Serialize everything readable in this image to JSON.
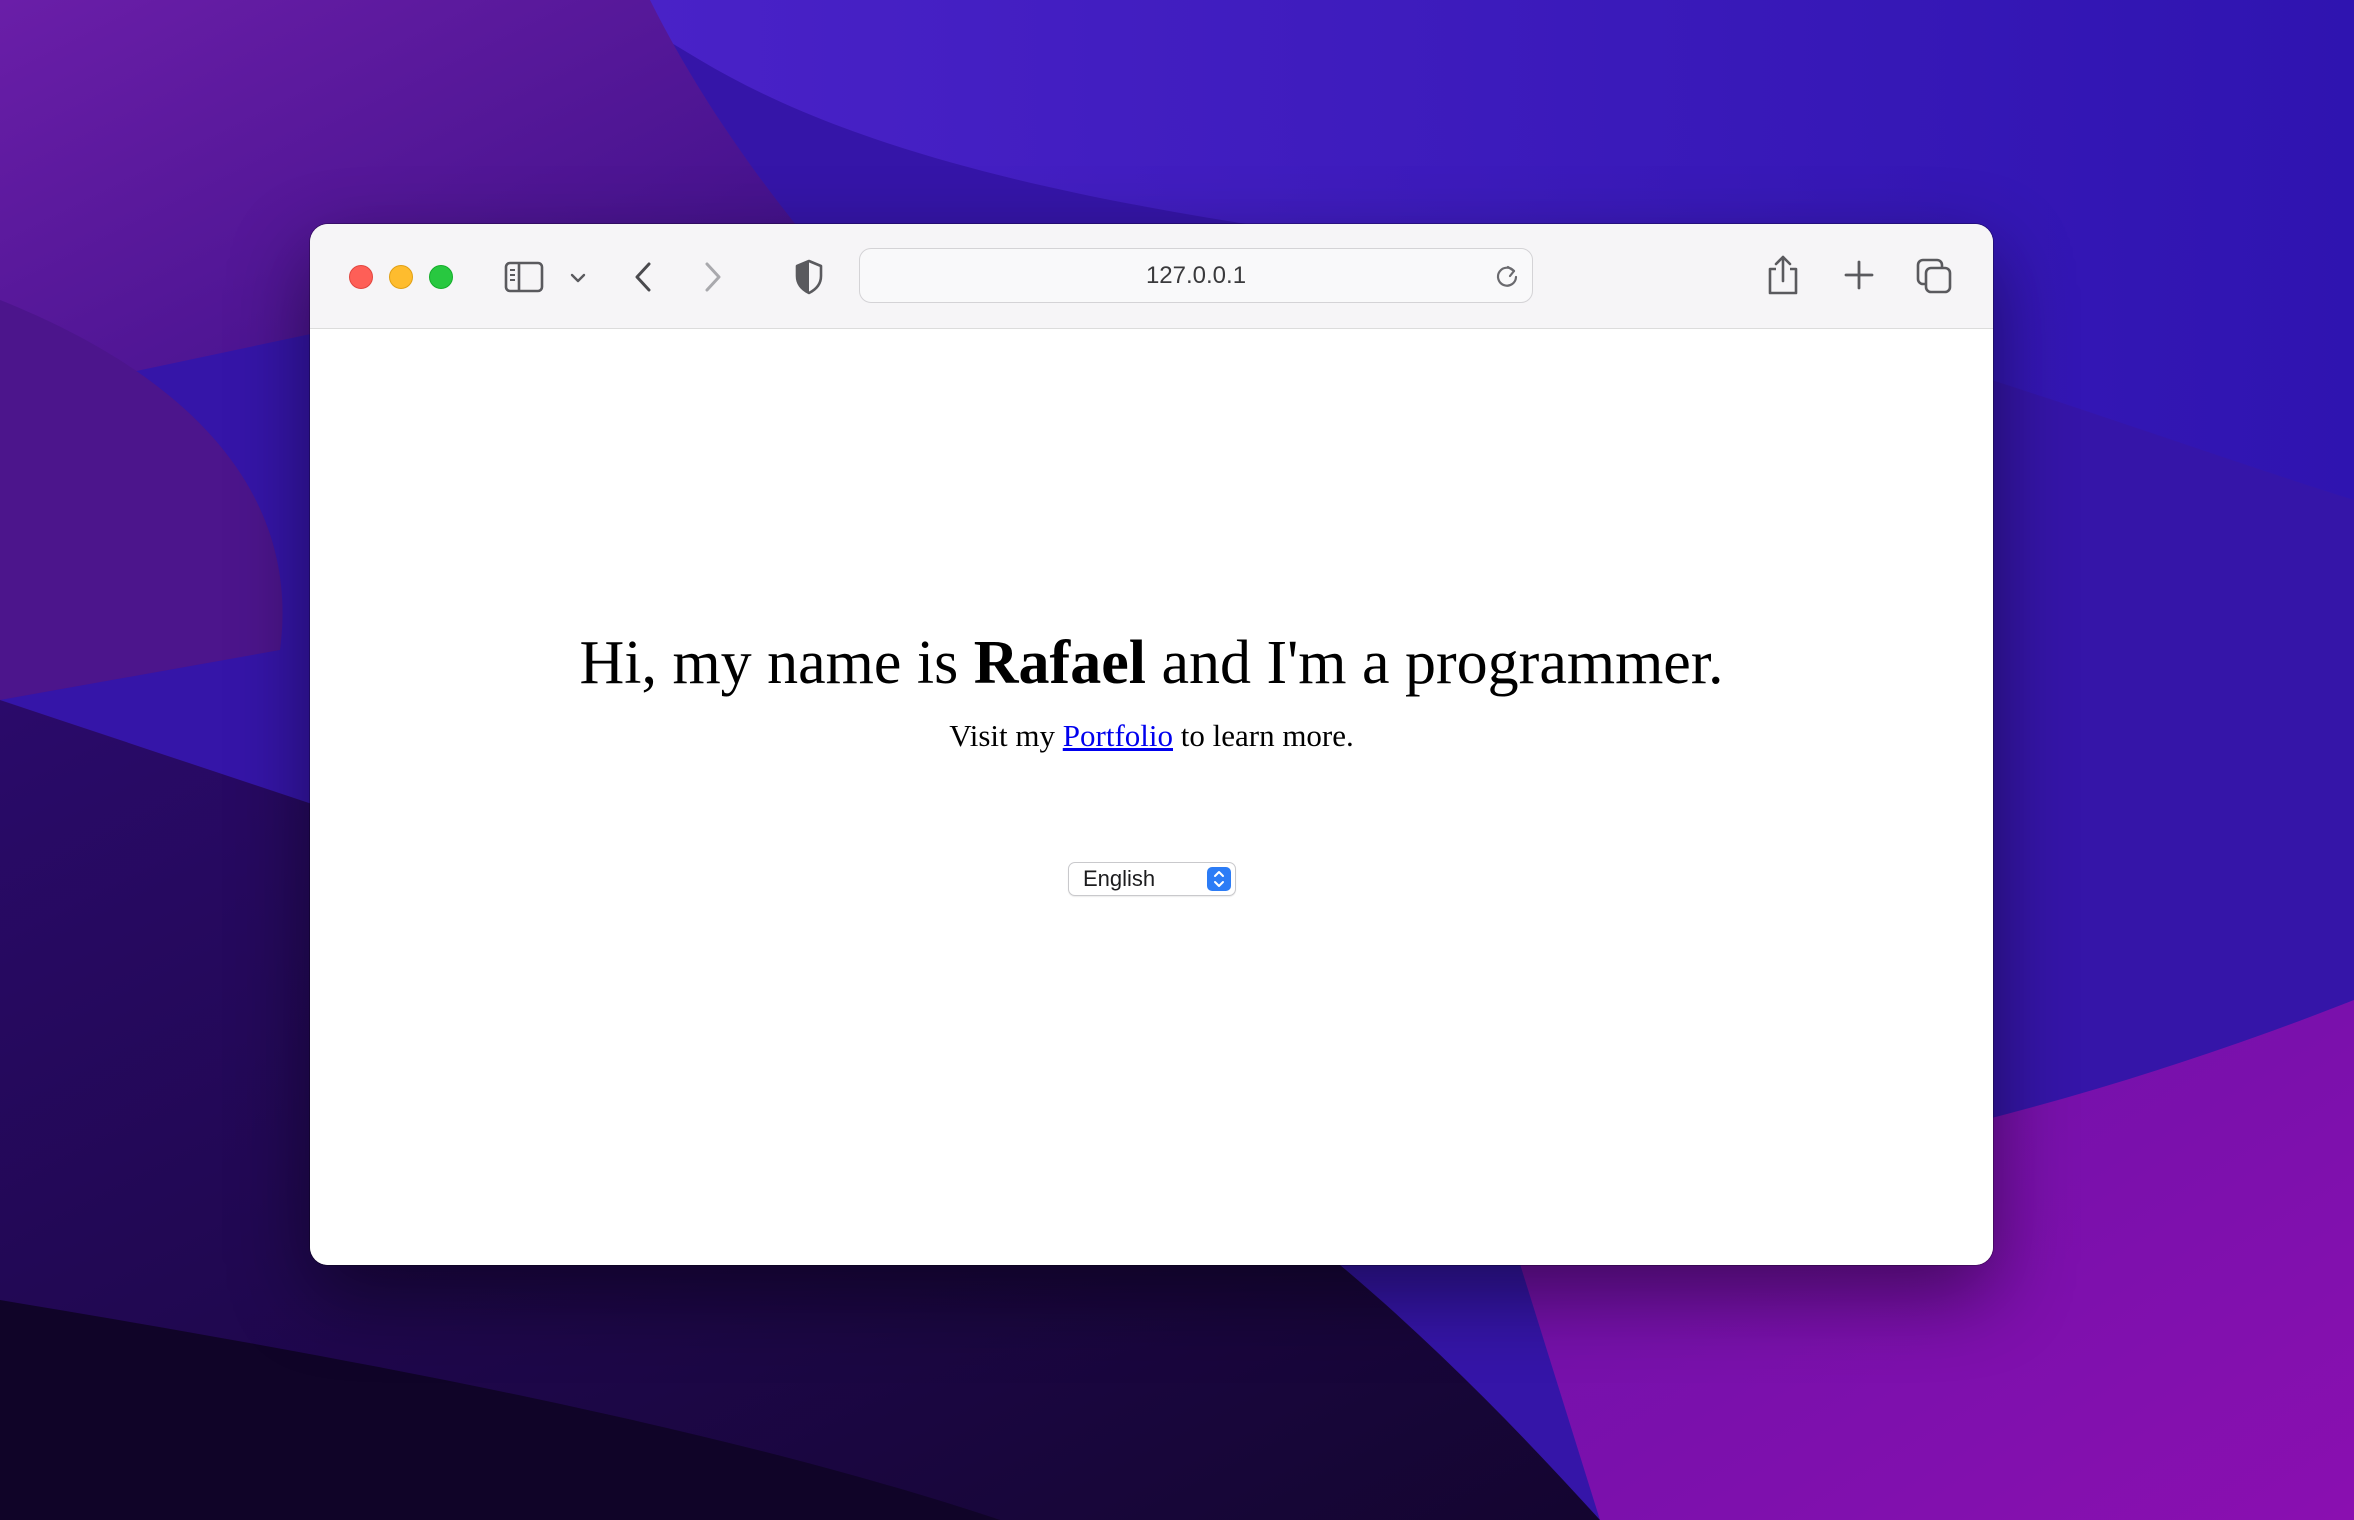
{
  "browser": {
    "address": "127.0.0.1",
    "icons": {
      "sidebar": "sidebar-icon",
      "sidebar_menu": "chevron-down-icon",
      "back": "chevron-left-icon",
      "forward": "chevron-right-icon",
      "privacy": "shield-icon",
      "reload": "reload-icon",
      "share": "share-icon",
      "new_tab": "plus-icon",
      "tab_overview": "tabs-icon"
    },
    "colors": {
      "close": "#fe5f57",
      "minimize": "#febc2e",
      "zoom": "#28c840"
    }
  },
  "page": {
    "headline_prefix": "Hi, my name is ",
    "headline_name": "Rafael",
    "headline_suffix": " and I'm a programmer.",
    "sub_prefix": "Visit my ",
    "sub_link": "Portfolio",
    "sub_suffix": " to learn more.",
    "language_selected": "English",
    "link_color": "#0000ee",
    "select_accent": "#2c7cf6"
  }
}
